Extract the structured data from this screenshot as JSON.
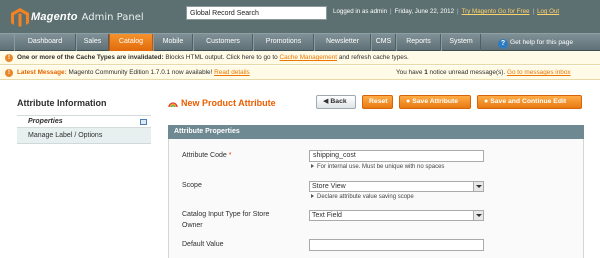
{
  "header": {
    "logo_word": "Magento",
    "logo_sub": "Admin Panel",
    "search_value": "Global Record Search",
    "logged_in": "Logged in as admin",
    "date": "Friday, June 22, 2012",
    "try_link": "Try Magento Go for Free",
    "logout": "Log Out"
  },
  "nav": {
    "items": [
      {
        "label": "Dashboard"
      },
      {
        "label": "Sales"
      },
      {
        "label": "Catalog"
      },
      {
        "label": "Mobile"
      },
      {
        "label": "Customers"
      },
      {
        "label": "Promotions"
      },
      {
        "label": "Newsletter"
      },
      {
        "label": "CMS"
      },
      {
        "label": "Reports"
      },
      {
        "label": "System"
      }
    ],
    "help": "Get help for this page"
  },
  "notices": {
    "cache": {
      "bold": "One or more of the Cache Types are invalidated:",
      "text": " Blocks HTML output. Click here to go to ",
      "link": "Cache Management",
      "tail": " and refresh cache types."
    },
    "latest": {
      "label": "Latest Message:",
      "text": " Magento Community Edition 1.7.0.1 now available! ",
      "link": "Read details",
      "right_prefix": "You have ",
      "right_count": "1",
      "right_mid": " notice unread message(s). ",
      "right_link": "Go to messages inbox"
    }
  },
  "sidebar": {
    "title": "Attribute Information",
    "tabs": [
      {
        "label": "Properties"
      },
      {
        "label": "Manage Label / Options"
      }
    ]
  },
  "page": {
    "title": "New Product Attribute",
    "buttons": {
      "back": "Back",
      "reset": "Reset",
      "save": "Save Attribute",
      "save_continue": "Save and Continue Edit"
    }
  },
  "form": {
    "section_title": "Attribute Properties",
    "attribute_code": {
      "label": "Attribute Code",
      "required_mark": "*",
      "value": "shipping_cost",
      "note": "For internal use. Must be unique with no spaces"
    },
    "scope": {
      "label": "Scope",
      "value": "Store View",
      "note": "Declare attribute value saving scope"
    },
    "input_type": {
      "label_line1": "Catalog Input Type for Store",
      "label_line2": "Owner",
      "value": "Text Field"
    },
    "default_value": {
      "label": "Default Value",
      "value": ""
    }
  }
}
